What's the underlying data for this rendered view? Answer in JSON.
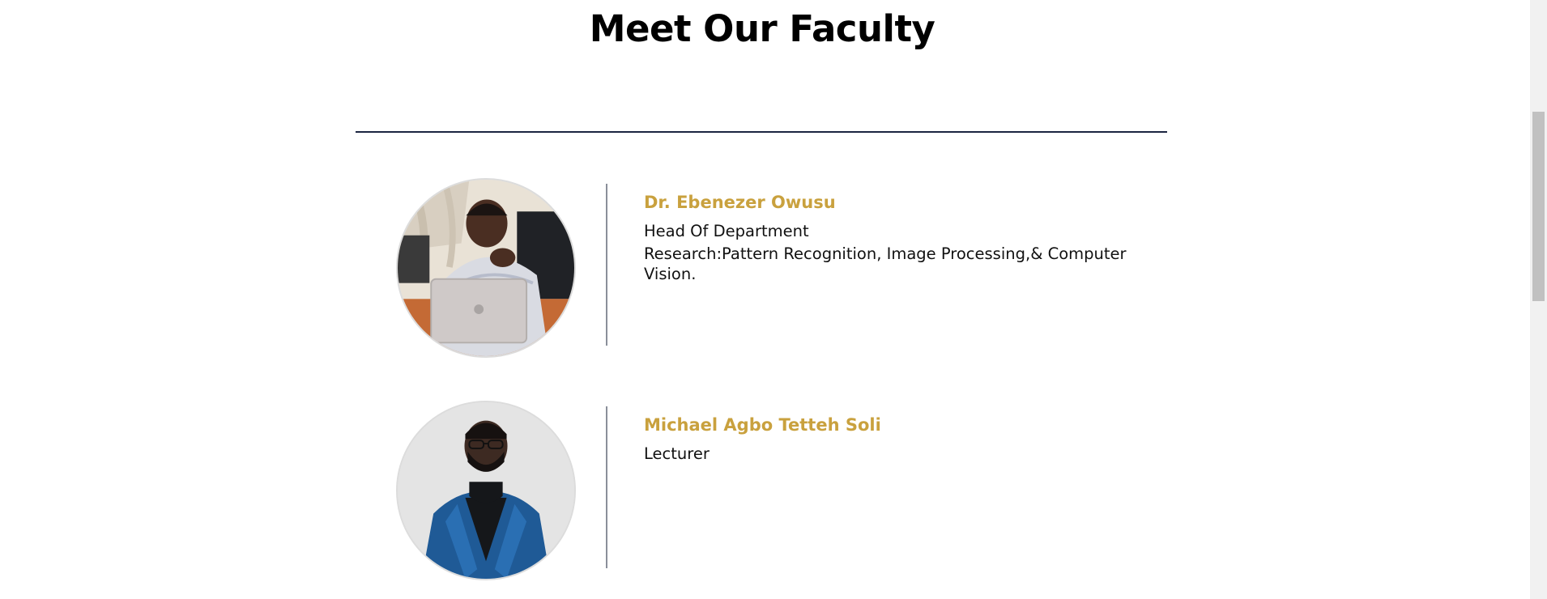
{
  "page": {
    "title": "Meet Our Faculty"
  },
  "colors": {
    "accent": "#c9a13e",
    "rule": "#1c2541",
    "text": "#111111"
  },
  "faculty": [
    {
      "name": "Dr. Ebenezer Owusu",
      "role": "Head Of Department",
      "research": "Research:Pattern Recognition, Image Processing,& Computer Vision.",
      "photo_icon": "portrait-photo"
    },
    {
      "name": "Michael Agbo Tetteh Soli",
      "role": "Lecturer",
      "research": "",
      "photo_icon": "portrait-photo"
    }
  ]
}
